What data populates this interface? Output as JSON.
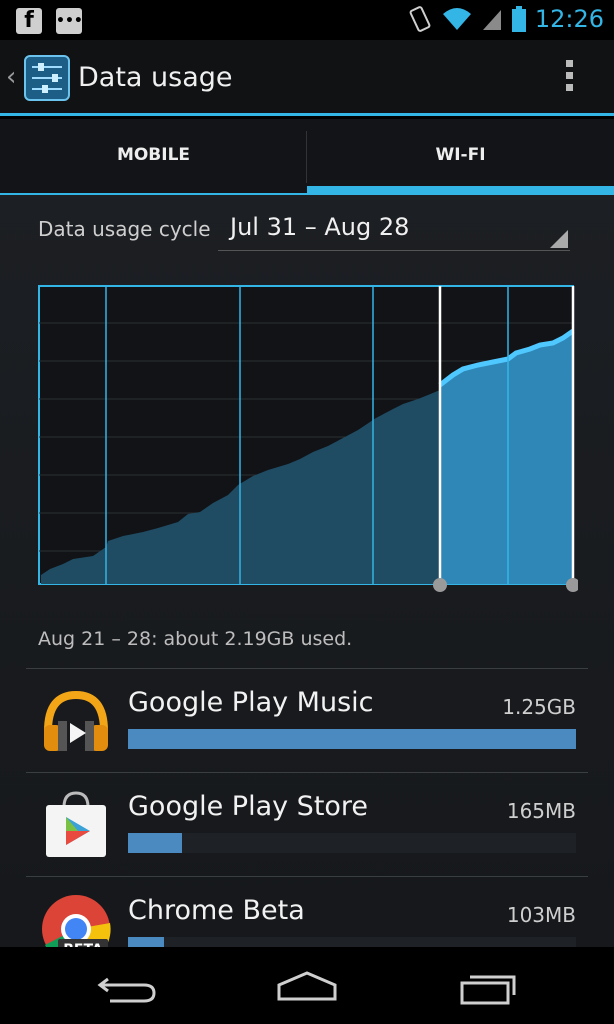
{
  "status_bar": {
    "time": "12:26",
    "icons": [
      "facebook-icon",
      "messaging-icon",
      "vibrate-icon",
      "wifi-icon",
      "signal-icon",
      "battery-icon"
    ],
    "accent": "#33b5e5"
  },
  "action_bar": {
    "title": "Data usage",
    "icon": "settings-sliders-icon"
  },
  "tabs": [
    {
      "label": "MOBILE",
      "selected": false
    },
    {
      "label": "WI-FI",
      "selected": true
    }
  ],
  "cycle": {
    "label": "Data usage cycle",
    "value": "Jul 31 – Aug 28"
  },
  "summary": "Aug 21 – 28: about 2.19GB used.",
  "apps": [
    {
      "name": "Google Play Music",
      "size": "1.25GB",
      "usage_fraction": 1.0,
      "icon": "headphones-icon"
    },
    {
      "name": "Google Play Store",
      "size": "165MB",
      "usage_fraction": 0.12,
      "icon": "play-store-bag-icon"
    },
    {
      "name": "Chrome Beta",
      "size": "103MB",
      "usage_fraction": 0.08,
      "icon": "chrome-beta-icon",
      "badge": "BETA"
    }
  ],
  "nav": [
    "back-icon",
    "home-icon",
    "recents-icon"
  ]
}
